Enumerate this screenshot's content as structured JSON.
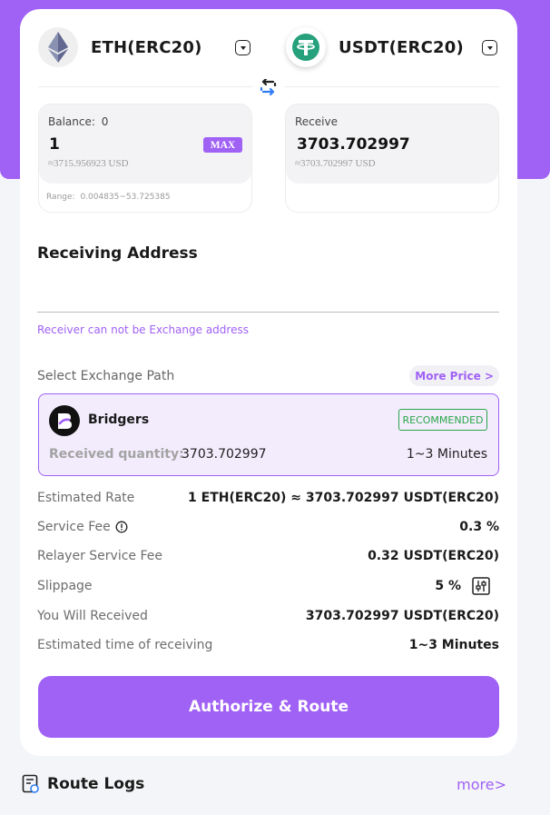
{
  "from_token": {
    "name": "ETH(ERC20)",
    "icon": "ethereum-icon"
  },
  "to_token": {
    "name": "USDT(ERC20)",
    "icon": "tether-icon"
  },
  "from_box": {
    "balance_label": "Balance:",
    "balance_value": "0",
    "amount": "1",
    "usd": "≈3715.956923 USD",
    "max_label": "MAX",
    "range_label": "Range:",
    "range_value": "0.004835~53.725385"
  },
  "to_box": {
    "label": "Receive",
    "amount": "3703.702997",
    "usd": "≈3703.702997 USD"
  },
  "receiving": {
    "title": "Receiving Address",
    "value": "",
    "warning": "Receiver can not be Exchange address"
  },
  "path": {
    "label": "Select Exchange Path",
    "more_price": "More Price >"
  },
  "route": {
    "name": "Bridgers",
    "badge": "RECOMMENDED",
    "received_label": "Received quantity:",
    "received_value": "3703.702997",
    "time": "1~3 Minutes"
  },
  "details": {
    "rate_label": "Estimated Rate",
    "rate_value": "1 ETH(ERC20) ≈ 3703.702997 USDT(ERC20)",
    "fee_label": "Service Fee",
    "fee_value": "0.3 %",
    "relayer_label": "Relayer Service Fee",
    "relayer_value": "0.32 USDT(ERC20)",
    "slippage_label": "Slippage",
    "slippage_value": "5 %",
    "received_label": "You Will Received",
    "received_value": "3703.702997 USDT(ERC20)",
    "time_label": "Estimated time of receiving",
    "time_value": "1~3 Minutes"
  },
  "action": {
    "button": "Authorize & Route"
  },
  "logs": {
    "title": "Route Logs",
    "more": "more>"
  },
  "colors": {
    "accent": "#a061f5",
    "success": "#29a648",
    "tether": "#26a17b"
  }
}
